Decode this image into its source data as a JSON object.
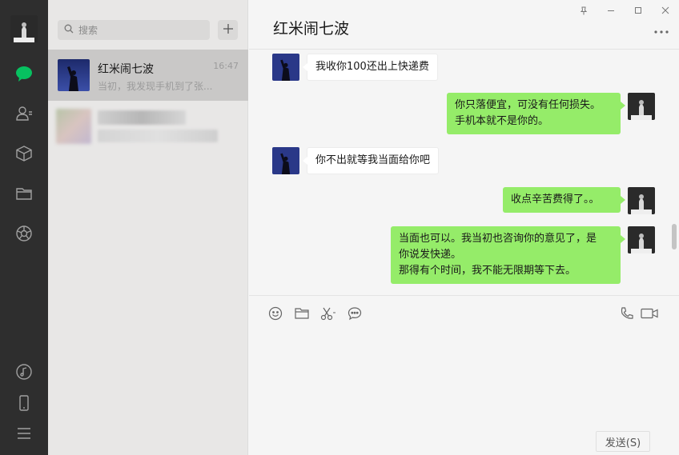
{
  "sidebar": {
    "nav": [
      {
        "name": "chat-icon",
        "active": true
      },
      {
        "name": "contacts-icon"
      },
      {
        "name": "box-icon"
      },
      {
        "name": "folder-icon"
      },
      {
        "name": "moments-icon"
      }
    ],
    "bottom": [
      "music-icon",
      "phone-icon",
      "menu-icon"
    ],
    "active_color": "#07c160"
  },
  "search": {
    "placeholder": "搜索"
  },
  "conversations": [
    {
      "name": "红米闹七波",
      "time": "16:47",
      "preview": "当初，我发现手机到了张..."
    }
  ],
  "chat": {
    "title": "红米闹七波",
    "messages": [
      {
        "side": "in",
        "text": "我收你100还出上快递费"
      },
      {
        "side": "out",
        "lines": [
          "你只落便宜，可没有任何损失。",
          "手机本就不是你的。"
        ]
      },
      {
        "side": "in",
        "text": "你不出就等我当面给你吧"
      },
      {
        "side": "out",
        "text": "收点辛苦费得了。。"
      },
      {
        "side": "out",
        "lines": [
          "当面也可以。我当初也咨询你的意见了，是",
          "你说发快递。",
          "那得有个时间，我不能无限期等下去。"
        ]
      }
    ],
    "send_label": "发送(S)"
  },
  "colors": {
    "bubble_out": "#95ec69",
    "rail": "#2e2e2e",
    "list_bg": "#e8e7e6"
  }
}
